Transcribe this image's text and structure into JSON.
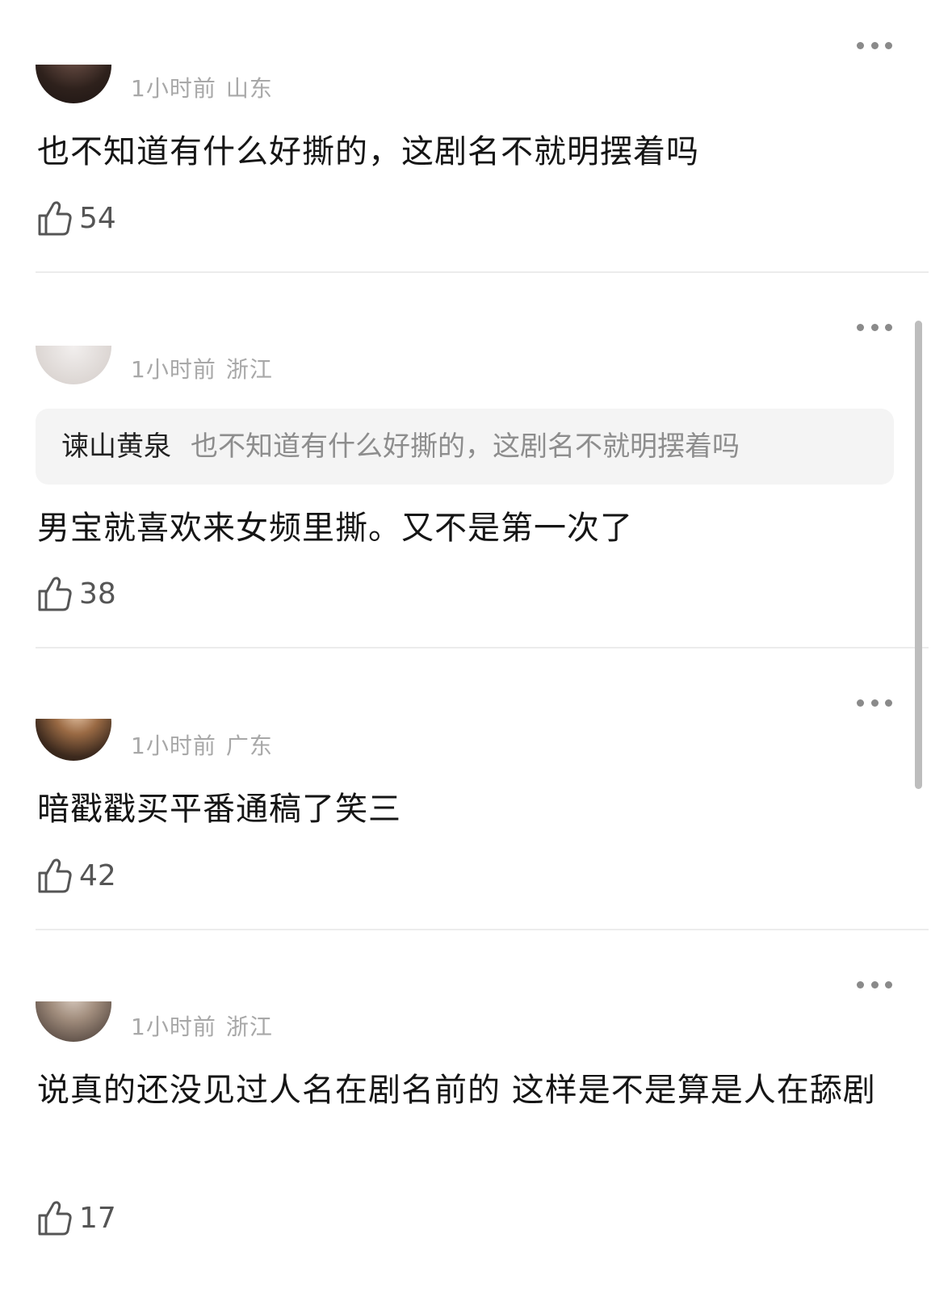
{
  "comments": [
    {
      "time": "1小时前",
      "location": "山东",
      "text": "也不知道有什么好撕的，这剧名不就明摆着吗",
      "likes": "54",
      "avatar_color": "#3a2a24"
    },
    {
      "time": "1小时前",
      "location": "浙江",
      "quote_author": "谏山黄泉",
      "quote_text": "也不知道有什么好撕的，这剧名不就明摆着吗",
      "text": "男宝就喜欢来女频里撕。又不是第一次了",
      "likes": "38",
      "avatar_color": "#e4dedb"
    },
    {
      "time": "1小时前",
      "location": "广东",
      "text": "暗戳戳买平番通稿了笑三",
      "likes": "42",
      "avatar_color": "#5a4030"
    },
    {
      "time": "1小时前",
      "location": "浙江",
      "text": "说真的还没见过人名在剧名前的 这样是不是算是人在舔剧",
      "likes": "17",
      "avatar_color": "#8c7c70"
    }
  ]
}
